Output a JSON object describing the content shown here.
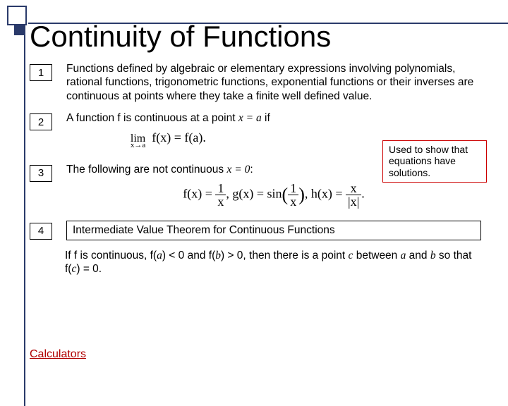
{
  "title": "Continuity of Functions",
  "items": {
    "n1": "1",
    "t1": "Functions defined by algebraic or elementary expressions involving polynomials, rational functions, trigonometric functions, exponential functions or their inverses are continuous at points where they take a finite well defined value.",
    "n2": "2",
    "t2_pre": "A function  f  is continuous at a point ",
    "t2_eq": "x = a",
    "t2_post": "  if",
    "formula2": "lim  f(x) = f(a).",
    "formula2_sub": "x→a",
    "n3": "3",
    "t3_pre": "The following are not continuous ",
    "t3_eq": "x = 0",
    "t3_post": ":",
    "note": "Used to show that equations have solutions.",
    "f3_a": "f(x) =",
    "f3_b": ", g(x) = sin",
    "f3_c": ", h(x) =",
    "f3_d": ".",
    "frac_1_num": "1",
    "frac_1_den": "x",
    "frac_2_num": "1",
    "frac_2_den": "x",
    "frac_3_num": "x",
    "frac_3_den": "|x|",
    "n4": "4",
    "t4": "Intermediate Value Theorem for Continuous Functions",
    "t4_body_a": "If  f  is continuous, f(",
    "t4_body_b": ") < 0 and f(",
    "t4_body_c": ") > 0, then there is a point ",
    "t4_body_d": "  between  ",
    "t4_body_e": "  and  ",
    "t4_body_f": "  so that f(",
    "t4_body_g": ") = 0.",
    "var_a": "a",
    "var_b": "b",
    "var_c": "c"
  },
  "link": "Calculators"
}
